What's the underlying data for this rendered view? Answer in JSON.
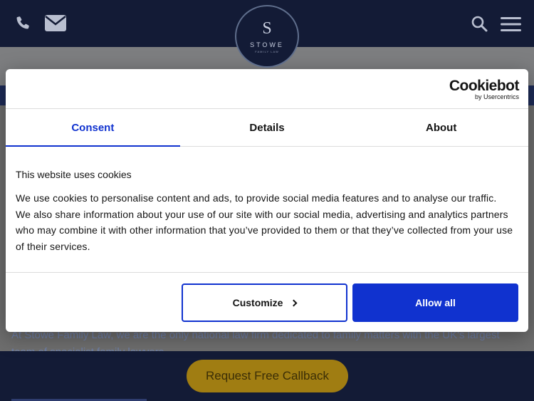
{
  "site": {
    "logo": {
      "letter": "S",
      "word": "STOWE",
      "sub": "FAMILY LAW"
    },
    "background_text": "At Stowe Family Law, we are the only national law firm dedicated to family matters with the UK's largest team of specialist family lawyers.",
    "callback_label": "Request Free Callback",
    "icons": [
      "phone-icon",
      "envelope-icon",
      "search-icon",
      "menu-icon"
    ]
  },
  "cookie_dialog": {
    "brand_name": "Cookiebot",
    "brand_sub": "by Usercentrics",
    "tabs": [
      {
        "label": "Consent",
        "active": true
      },
      {
        "label": "Details",
        "active": false
      },
      {
        "label": "About",
        "active": false
      }
    ],
    "title": "This website uses cookies",
    "body": "We use cookies to personalise content and ads, to provide social media features and to analyse our traffic. We also share information about your use of our site with our social media, advertising and analytics partners who may combine it with other information that you’ve provided to them or that they’ve collected from your use of their services.",
    "customize_label": "Customize",
    "allow_all_label": "Allow all"
  },
  "colors": {
    "accent": "#1032cf",
    "header_navy": "#131b36",
    "callback_gold": "#a07d12"
  }
}
